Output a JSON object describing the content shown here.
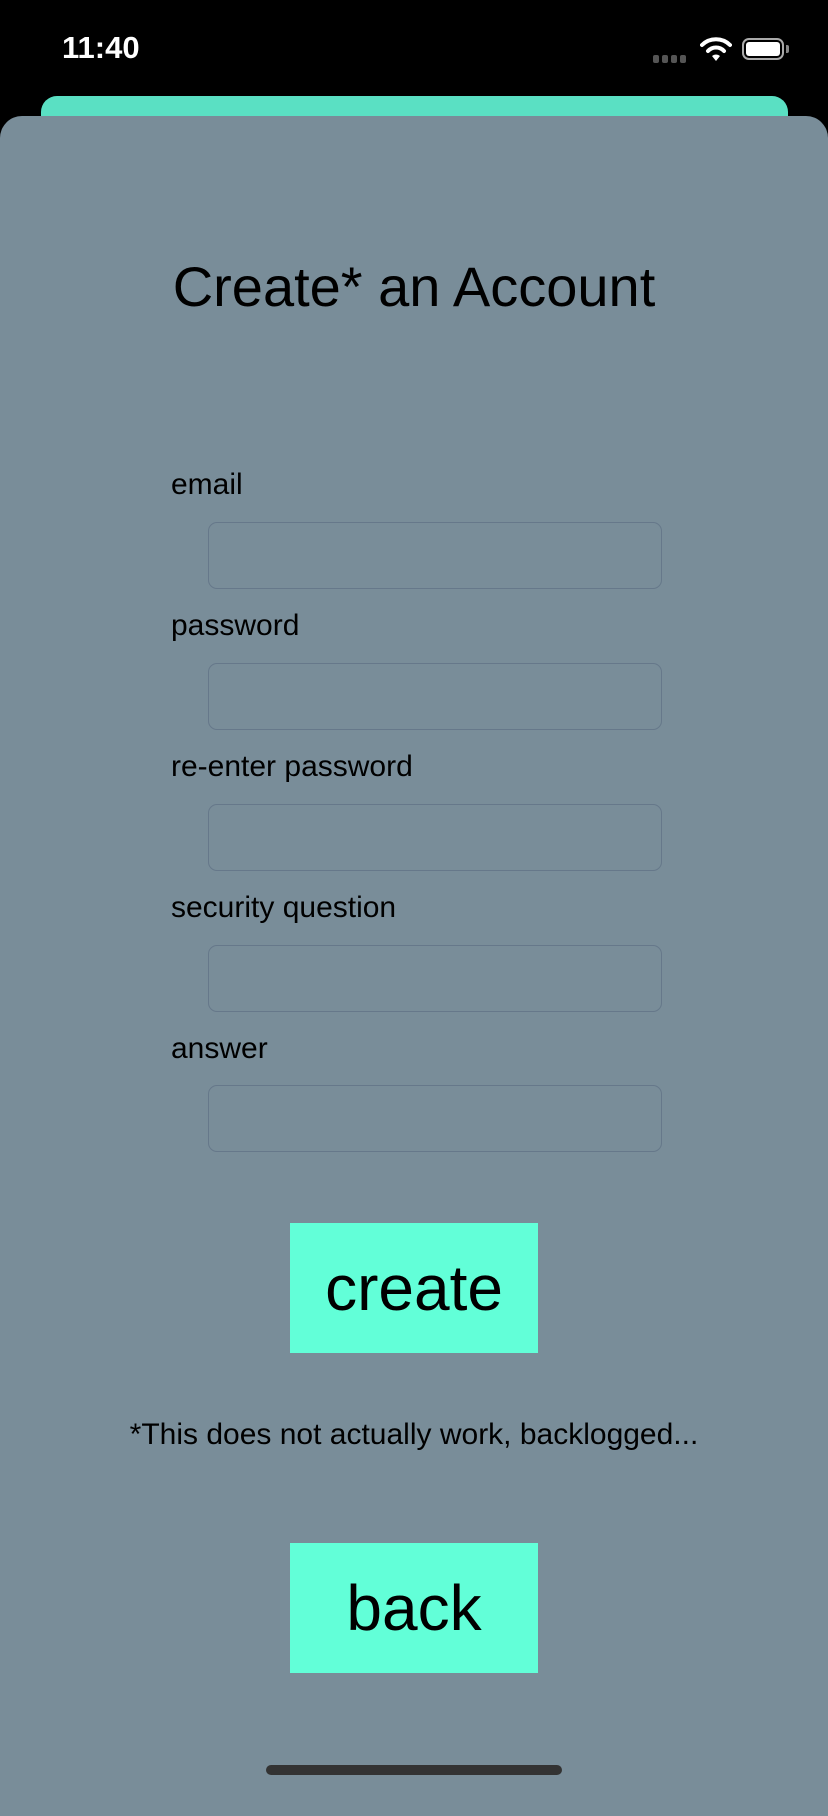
{
  "status_bar": {
    "time": "11:40",
    "icons": [
      "signal-icon",
      "wifi-icon",
      "battery-icon"
    ]
  },
  "page": {
    "title": "Create* an Account",
    "fields": [
      {
        "label": "email",
        "value": ""
      },
      {
        "label": "password",
        "value": ""
      },
      {
        "label": "re-enter password",
        "value": ""
      },
      {
        "label": "security question",
        "value": ""
      },
      {
        "label": "answer",
        "value": ""
      }
    ],
    "create_label": "create",
    "note": "*This does not actually work, backlogged...",
    "back_label": "back"
  },
  "colors": {
    "background": "#798d99",
    "accent": "#62ffd8",
    "sheet": "#5ae0c3"
  }
}
